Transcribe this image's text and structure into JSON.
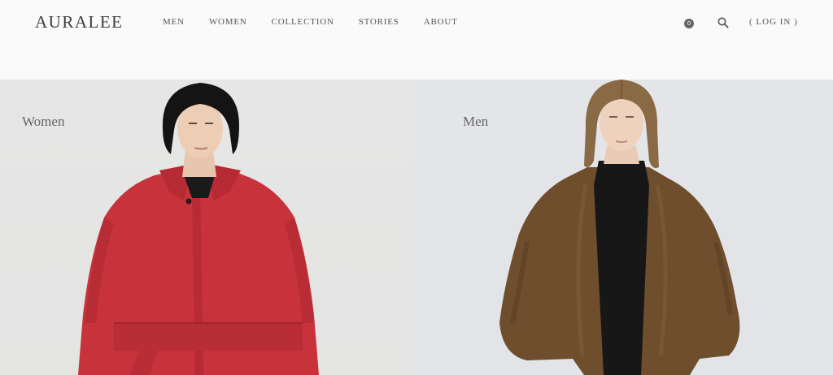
{
  "header": {
    "logo": "AURALEE",
    "nav": [
      {
        "label": "MEN"
      },
      {
        "label": "WOMEN"
      },
      {
        "label": "COLLECTION"
      },
      {
        "label": "STORIES"
      },
      {
        "label": "ABOUT"
      }
    ],
    "cart_count": "0",
    "search_icon": "search-icon",
    "login_label": "( LOG IN )"
  },
  "hero": {
    "women": {
      "label": "Women",
      "coat_color": "#c8323a"
    },
    "men": {
      "label": "Men",
      "coat_color": "#6b4a2b"
    }
  }
}
